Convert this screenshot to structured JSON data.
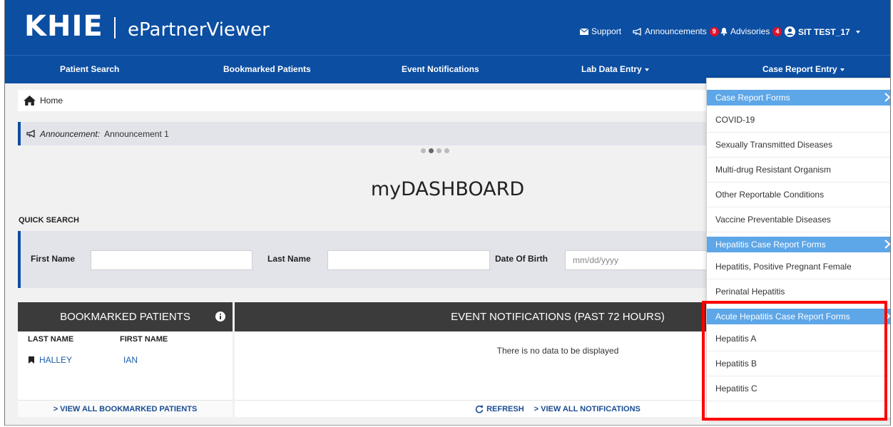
{
  "header": {
    "logo": "KHIE",
    "app_title": "ePartnerViewer",
    "support": "Support",
    "announcements": "Announcements",
    "announcements_count": "9",
    "advisories": "Advisories",
    "advisories_count": "4",
    "user": "SIT TEST_17"
  },
  "nav": {
    "patient_search": "Patient Search",
    "bookmarked": "Bookmarked Patients",
    "events": "Event Notifications",
    "lab": "Lab Data Entry",
    "case": "Case Report Entry"
  },
  "breadcrumb": {
    "home": "Home"
  },
  "announcement": {
    "label": "Announcement:",
    "text": "Announcement 1"
  },
  "dashboard": {
    "title": "myDASHBOARD"
  },
  "quick_search": {
    "title": "QUICK SEARCH",
    "first_name": "First Name",
    "last_name": "Last Name",
    "dob": "Date Of Birth",
    "dob_placeholder": "mm/dd/yyyy"
  },
  "bookmarked": {
    "title": "BOOKMARKED PATIENTS",
    "col_last": "LAST NAME",
    "col_first": "FIRST NAME",
    "rows": [
      {
        "last": "HALLEY",
        "first": "IAN"
      }
    ],
    "view_all": "> VIEW ALL BOOKMARKED PATIENTS"
  },
  "events": {
    "title": "EVENT NOTIFICATIONS (PAST 72 HOURS)",
    "empty": "There is no data to be displayed",
    "refresh": "REFRESH",
    "view_all": "> VIEW ALL NOTIFICATIONS"
  },
  "case_menu": {
    "case_forms": "Case Report Forms",
    "items": [
      "COVID-19",
      "Sexually Transmitted Diseases",
      "Multi-drug Resistant Organism",
      "Other Reportable Conditions",
      "Vaccine Preventable Diseases"
    ],
    "hep_forms": "Hepatitis Case Report Forms",
    "hep_items": [
      "Hepatitis, Positive Pregnant Female",
      "Perinatal Hepatitis"
    ],
    "acute_forms": "Acute Hepatitis Case Report Forms",
    "acute_items": [
      "Hepatitis A",
      "Hepatitis B",
      "Hepatitis C"
    ]
  },
  "colors": {
    "brand_blue": "#0b4ea2",
    "menu_header": "#5da6e8",
    "badge_red": "#e0102a",
    "highlight": "#ff0000"
  }
}
